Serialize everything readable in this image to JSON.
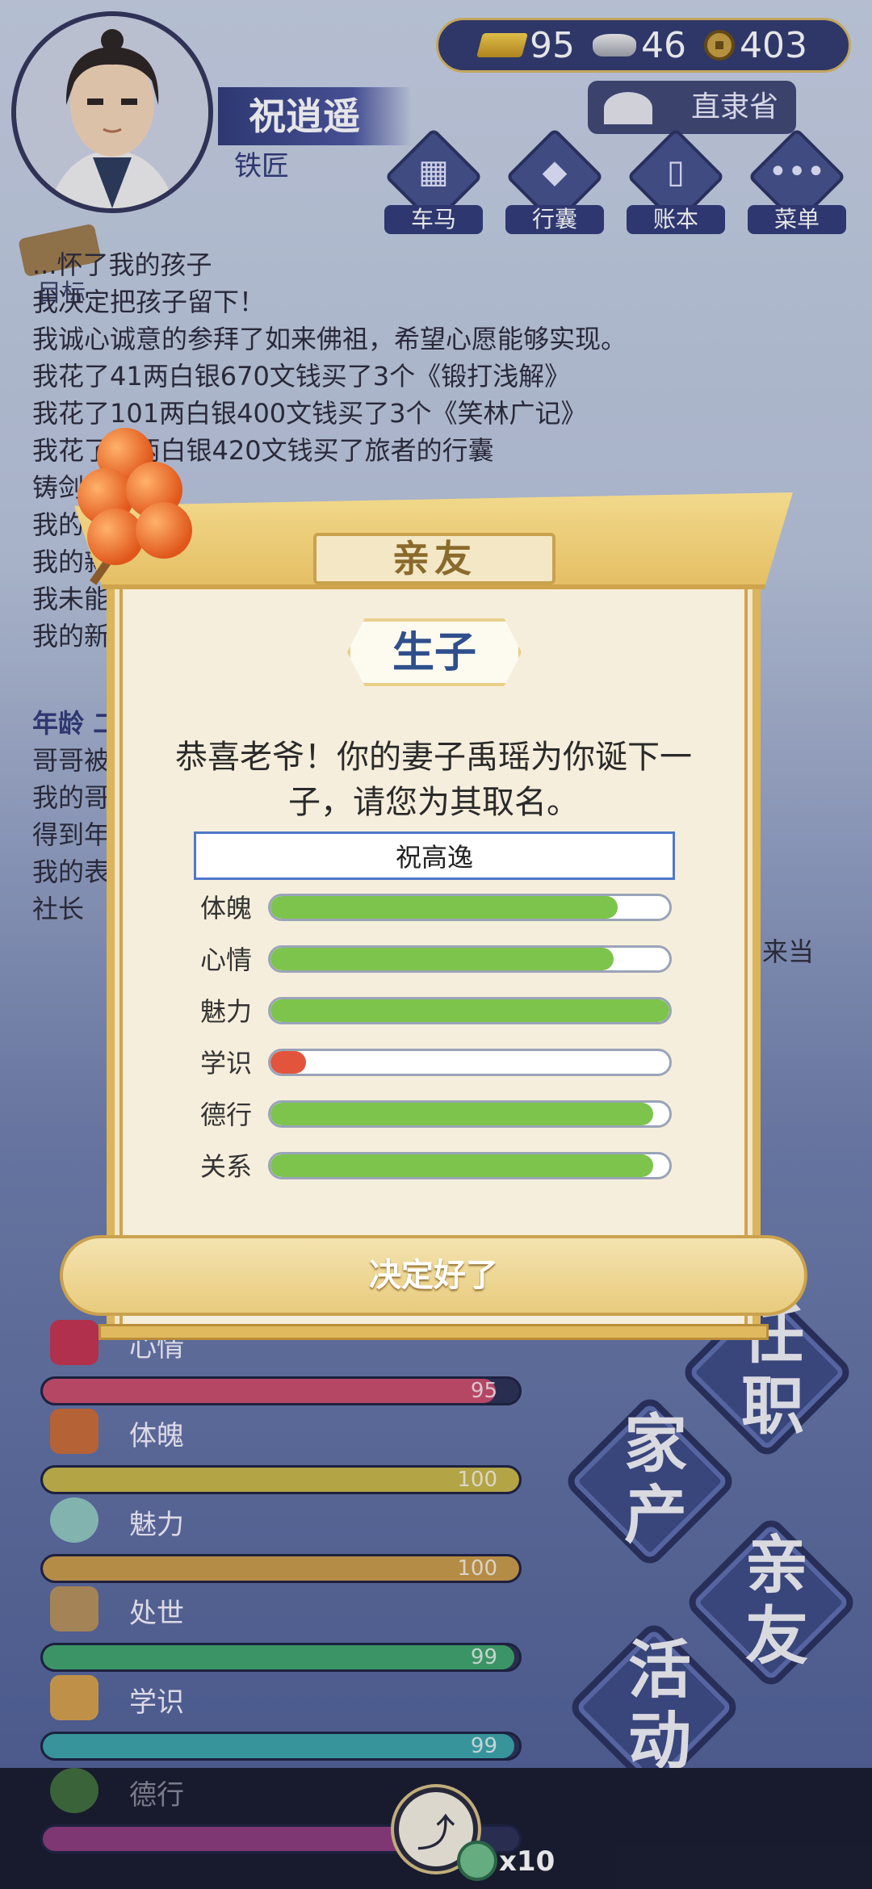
{
  "header": {
    "player_name": "祝逍遥",
    "player_job": "铁匠",
    "gold": "95",
    "silver": "46",
    "coins": "403",
    "province": "直隶省",
    "menu": [
      {
        "label": "车马",
        "icon": "carriage-icon"
      },
      {
        "label": "行囊",
        "icon": "bag-icon"
      },
      {
        "label": "账本",
        "icon": "ledger-icon"
      },
      {
        "label": "菜单",
        "icon": "more-icon"
      }
    ]
  },
  "goal": {
    "label": "目标"
  },
  "log": {
    "lines": [
      "...怀了我的孩子",
      "我决定把孩子留下！",
      "我诚心诚意的参拜了如来佛祖，希望心愿能够实现。",
      "我花了41两白银670文钱买了3个《锻打浅解》",
      "我花了101两白银400文钱买了3个《笑林广记》",
      "我花了...两白银420文钱买了旅者的行囊",
      "铸剑...",
      "我的...",
      "我的新...",
      "我未能...",
      "我的新..."
    ],
    "age_label": "年龄 二...",
    "lines2": [
      "哥哥被...",
      "我的哥...",
      "得到年...",
      "我的表...",
      "社长"
    ],
    "tail_right": "来当"
  },
  "modal": {
    "title": "亲友",
    "subtitle": "生子",
    "message": "恭喜老爷！你的妻子禹瑶为你诞下一子，请您为其取名。",
    "name_value": "祝高逸",
    "attributes": [
      {
        "label": "体魄",
        "value": 0.87,
        "color": "#7cc44c"
      },
      {
        "label": "心情",
        "value": 0.86,
        "color": "#7cc44c"
      },
      {
        "label": "魅力",
        "value": 1.0,
        "color": "#7cc44c"
      },
      {
        "label": "学识",
        "value": 0.09,
        "color": "#e2553c"
      },
      {
        "label": "德行",
        "value": 0.96,
        "color": "#7cc44c"
      },
      {
        "label": "关系",
        "value": 0.96,
        "color": "#7cc44c"
      }
    ],
    "confirm_label": "决定好了"
  },
  "stats": [
    {
      "label": "心情",
      "value": "95",
      "color": "#c94c6c",
      "icon": "flower-icon",
      "fraction": 0.95
    },
    {
      "label": "体魄",
      "value": "100",
      "color": "#c7b648",
      "icon": "body-icon",
      "fraction": 1.0
    },
    {
      "label": "魅力",
      "value": "100",
      "color": "#c99a48",
      "icon": "mirror-icon",
      "fraction": 1.0
    },
    {
      "label": "处世",
      "value": "99",
      "color": "#3ea36b",
      "icon": "ruler-icon",
      "fraction": 0.99
    },
    {
      "label": "学识",
      "value": "99",
      "color": "#3aa3a8",
      "icon": "book-icon",
      "fraction": 0.99
    },
    {
      "label": "德行",
      "value": "",
      "color": "#8a3a7a",
      "icon": "dish-icon",
      "fraction": 0.9
    }
  ],
  "side_buttons": [
    {
      "label": "任职"
    },
    {
      "label": "家产"
    },
    {
      "label": "亲友"
    },
    {
      "label": "活动"
    }
  ],
  "share": {
    "count": "x10"
  }
}
